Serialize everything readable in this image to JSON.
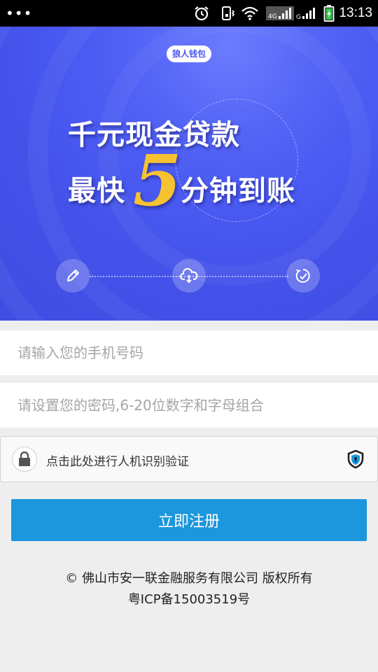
{
  "status_bar": {
    "dots": "•••",
    "time": "13:13",
    "icons": [
      "alarm-icon",
      "vibrate-icon",
      "wifi-icon",
      "signal-4g-icon",
      "signal-icon",
      "battery-charging-icon"
    ]
  },
  "banner": {
    "badge": "狼人钱包",
    "headline_line1": "千元现金贷款",
    "headline_line2_prefix": "最快",
    "headline_number": "5",
    "headline_line2_suffix": "分钟到账",
    "steps": [
      "pencil-icon",
      "cloud-download-icon",
      "clock-check-icon"
    ]
  },
  "form": {
    "phone_placeholder": "请输入您的手机号码",
    "password_placeholder": "请设置您的密码,6-20位数字和字母组合",
    "captcha_label": "点击此处进行人机识别验证",
    "register_label": "立即注册"
  },
  "footer": {
    "copyright": "© 佛山市安一联金融服务有限公司 版权所有",
    "icp": "粤ICP备15003519号"
  },
  "colors": {
    "banner": "#4a5af2",
    "accent_yellow": "#f7c232",
    "button": "#1c96dc",
    "background": "#eeeeee"
  }
}
